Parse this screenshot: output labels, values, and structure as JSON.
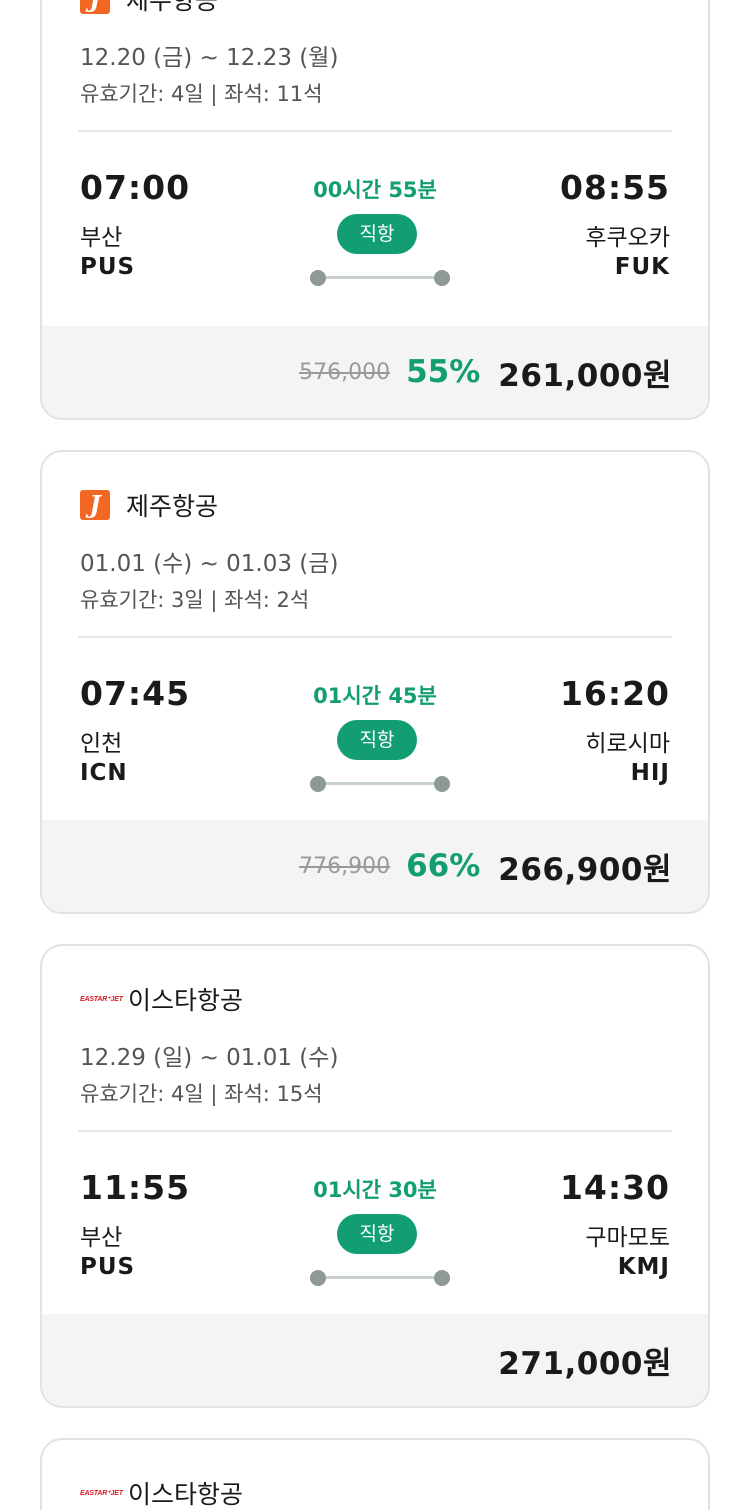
{
  "flights": [
    {
      "airline": "제주항공",
      "logo": "jeju-air-logo",
      "dates": "12.20 (금) ~ 12.23 (월)",
      "validity": "유효기간: 4일 | 좌석: 11석",
      "dep_time": "07:00",
      "dep_city": "부산",
      "dep_code": "PUS",
      "duration": "00시간 55분",
      "direct": "직항",
      "arr_time": "08:55",
      "arr_city": "후쿠오카",
      "arr_code": "FUK",
      "original_price": "576,000",
      "discount": "55%",
      "price": "261,000원"
    },
    {
      "airline": "제주항공",
      "logo": "jeju-air-logo",
      "dates": "01.01 (수) ~ 01.03 (금)",
      "validity": "유효기간: 3일 | 좌석: 2석",
      "dep_time": "07:45",
      "dep_city": "인천",
      "dep_code": "ICN",
      "duration": "01시간 45분",
      "direct": "직항",
      "arr_time": "16:20",
      "arr_city": "히로시마",
      "arr_code": "HIJ",
      "original_price": "776,900",
      "discount": "66%",
      "price": "266,900원"
    },
    {
      "airline": "이스타항공",
      "logo": "eastar-jet-logo",
      "logo_text": "EASTAR⁺JET",
      "dates": "12.29 (일) ~ 01.01 (수)",
      "validity": "유효기간: 4일 | 좌석: 15석",
      "dep_time": "11:55",
      "dep_city": "부산",
      "dep_code": "PUS",
      "duration": "01시간 30분",
      "direct": "직항",
      "arr_time": "14:30",
      "arr_city": "구마모토",
      "arr_code": "KMJ",
      "original_price": "",
      "discount": "",
      "price": "271,000원"
    },
    {
      "airline": "이스타항공",
      "logo": "eastar-jet-logo",
      "logo_text": "EASTAR⁺JET"
    }
  ],
  "colors": {
    "accent": "#129e72",
    "jeju": "#f26722",
    "eastar": "#d71920"
  }
}
